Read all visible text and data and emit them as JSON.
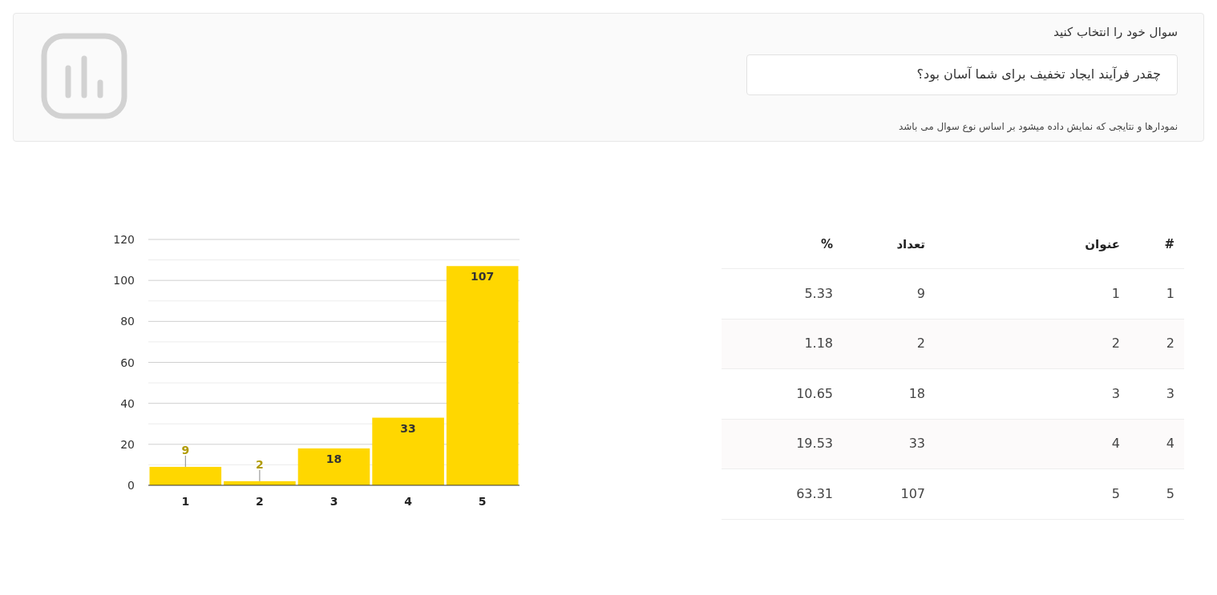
{
  "header": {
    "label": "سوال خود را انتخاب کنید",
    "question": "چقدر فرآیند ایجاد تخفیف برای شما آسان بود؟",
    "note": "نمودارها و نتایجی که نمایش داده میشود بر اساس نوع سوال می باشد"
  },
  "chart": {
    "chart_data": {
      "type": "bar",
      "categories": [
        "1",
        "2",
        "3",
        "4",
        "5"
      ],
      "series": [
        {
          "color": "#ffd700",
          "values": [
            9,
            2,
            18,
            33,
            107
          ]
        }
      ],
      "ylim": [
        0,
        120
      ],
      "yticks": [
        0,
        20,
        40,
        60,
        80,
        100,
        120
      ],
      "data_labels": true,
      "grid": true
    }
  },
  "table": {
    "columns": [
      "#",
      "عنوان",
      "تعداد",
      "%"
    ],
    "rows": [
      [
        "1",
        "1",
        "9",
        "5.33"
      ],
      [
        "2",
        "2",
        "2",
        "1.18"
      ],
      [
        "3",
        "3",
        "18",
        "10.65"
      ],
      [
        "4",
        "4",
        "33",
        "19.53"
      ],
      [
        "5",
        "5",
        "107",
        "63.31"
      ]
    ]
  }
}
